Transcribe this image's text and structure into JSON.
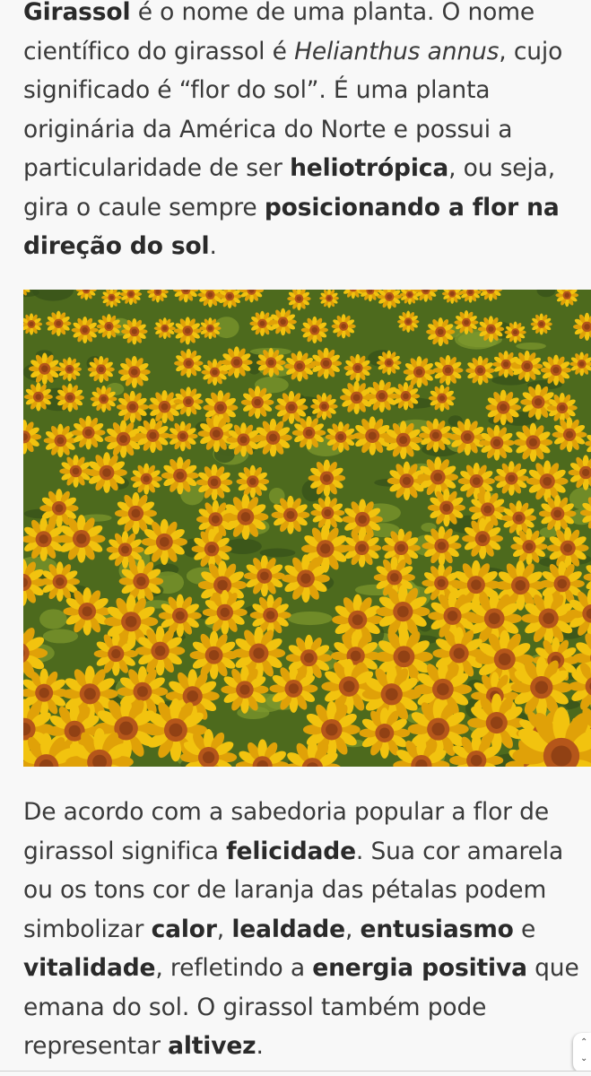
{
  "paragraph1": {
    "s1_bold": "Girassol",
    "s2": " é o nome de uma planta. O nome científico do girassol é ",
    "s3_italic": "Helianthus annus",
    "s4": ", cujo significado é “flor do sol”. É uma planta originária da América do Norte e possui a particularidade de ser ",
    "s5_bold": "heliotrópica",
    "s6": ", ou seja, gira o caule sempre ",
    "s7_bold": "posicionando a flor na direção do sol",
    "s8": "."
  },
  "image": {
    "subject": "sunflower field",
    "colors": {
      "petal": "#f2c30f",
      "petal_dark": "#e0a108",
      "center": "#b5561a",
      "leaf": "#4d6a1d",
      "leaf_light": "#7f9a2e"
    }
  },
  "paragraph2": {
    "s1": "De acordo com a sabedoria popular a flor de girassol significa ",
    "s2_bold": "felicidade",
    "s3": ". Sua cor amarela ou os tons cor de laranja das pétalas podem simbolizar ",
    "s4_bold": "calor",
    "s5": ", ",
    "s6_bold": "lealdade",
    "s7": ", ",
    "s8_bold": "entusiasmo",
    "s9": " e ",
    "s10_bold": "vitalidade",
    "s11": ", refletindo a ",
    "s12_bold": "energia positiva",
    "s13": " que emana do sol. O girassol também pode representar ",
    "s14_bold": "altivez",
    "s15": "."
  },
  "scroll_handle": {
    "icon": "scroll-chevrons-icon"
  }
}
